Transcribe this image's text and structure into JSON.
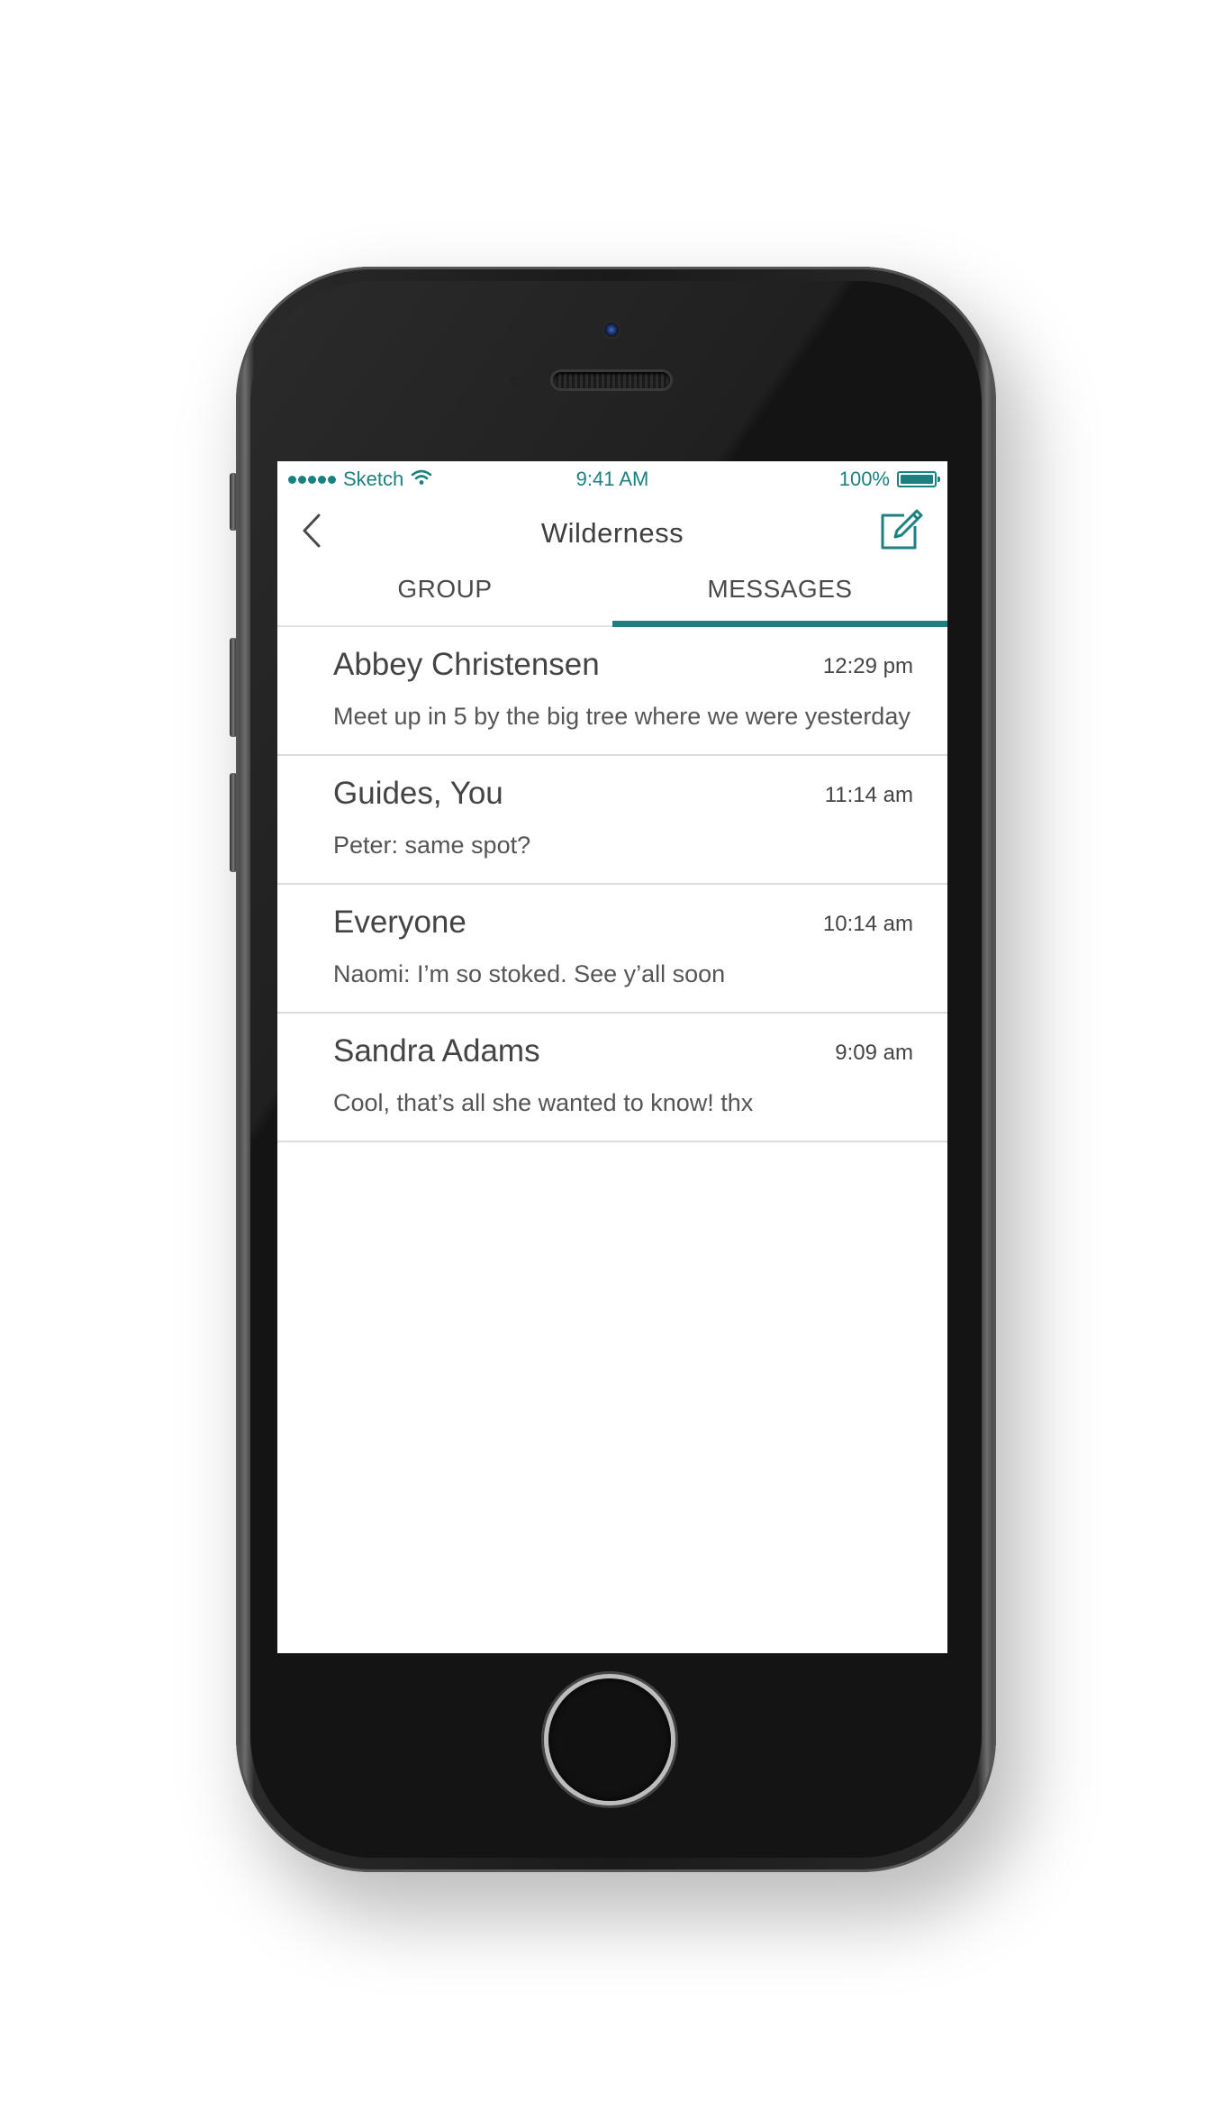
{
  "theme": {
    "accent": "#1d8080",
    "text": "#444444",
    "divider": "#dcdcdc"
  },
  "status_bar": {
    "carrier": "Sketch",
    "time": "9:41 AM",
    "battery": "100%",
    "battery_level": 1.0
  },
  "nav": {
    "title": "Wilderness",
    "back_icon": "chevron-left-icon",
    "compose_icon": "compose-icon"
  },
  "tabs": [
    {
      "label": "GROUP",
      "active": false
    },
    {
      "label": "MESSAGES",
      "active": true
    }
  ],
  "threads": [
    {
      "name": "Abbey Christensen",
      "time": "12:29 pm",
      "preview": "Meet up in 5 by the big tree where we were yesterday"
    },
    {
      "name": "Guides, You",
      "time": "11:14 am",
      "preview": "Peter: same spot?"
    },
    {
      "name": "Everyone",
      "time": "10:14 am",
      "preview": "Naomi: I’m so stoked. See y’all soon"
    },
    {
      "name": "Sandra Adams",
      "time": "9:09 am",
      "preview": "Cool, that’s all she wanted to know! thx"
    }
  ]
}
